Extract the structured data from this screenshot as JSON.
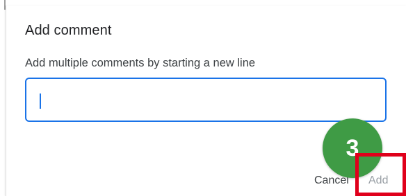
{
  "dialog": {
    "title": "Add comment",
    "hint": "Add multiple comments by starting a new line",
    "input_value": "",
    "cancel_label": "Cancel",
    "add_label": "Add"
  },
  "annotation": {
    "step_number": "3",
    "step_color": "#3f9b45",
    "highlight_color": "#e0001b"
  },
  "colors": {
    "accent": "#1a73e8",
    "disabled_text": "#9aa0a6"
  }
}
